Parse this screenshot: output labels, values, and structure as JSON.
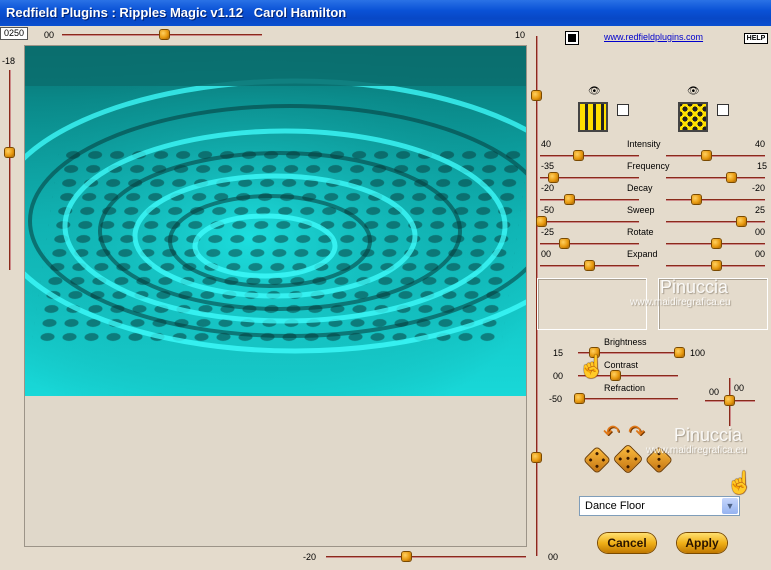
{
  "window": {
    "title": "Redfield Plugins : Ripples Magic v1.12   Carol Hamilton"
  },
  "top": {
    "seed_value": "0250",
    "slider_left_label": "00",
    "slider_right_label": "10",
    "link": "www.redfieldplugins.com",
    "help": "HELP"
  },
  "left_slider": {
    "label": "-18"
  },
  "bottom_slider": {
    "left_label": "-20",
    "right_label": "00"
  },
  "params": [
    {
      "name": "Intensity",
      "left": "40",
      "right": "40"
    },
    {
      "name": "Frequency",
      "left": "-35",
      "right": "15"
    },
    {
      "name": "Decay",
      "left": "-20",
      "right": "-20"
    },
    {
      "name": "Sweep",
      "left": "-50",
      "right": "25"
    },
    {
      "name": "Rotate",
      "left": "-25",
      "right": "00"
    },
    {
      "name": "Expand",
      "left": "00",
      "right": "00"
    }
  ],
  "lighting": {
    "brightness_label": "Brightness",
    "brightness_left": "15",
    "brightness_right": "100",
    "contrast_label": "Contrast",
    "contrast_left": "00",
    "refraction_label": "Refraction",
    "refraction_left": "-50",
    "xy_left": "00",
    "xy_right": "00"
  },
  "preset": {
    "selected": "Dance Floor"
  },
  "buttons": {
    "cancel": "Cancel",
    "apply": "Apply"
  },
  "watermark": {
    "name": "Pinuccia",
    "site": "www.maidiregrafica.eu"
  }
}
